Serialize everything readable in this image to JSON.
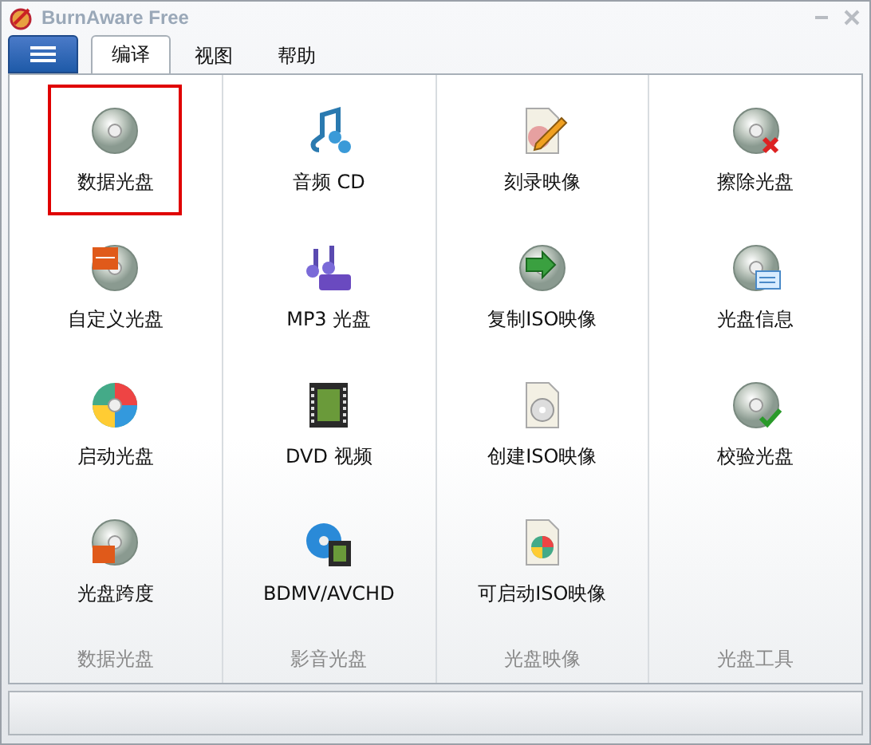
{
  "window": {
    "title": "BurnAware Free"
  },
  "tabs": [
    {
      "label": "编译",
      "selected": true
    },
    {
      "label": "视图",
      "selected": false
    },
    {
      "label": "帮助",
      "selected": false
    }
  ],
  "groups": [
    {
      "label": "数据光盘",
      "items": [
        {
          "label": "数据光盘",
          "kind": "disc",
          "selected": true
        },
        {
          "label": "自定义光盘",
          "kind": "iso",
          "selected": false
        },
        {
          "label": "启动光盘",
          "kind": "boot",
          "selected": false
        },
        {
          "label": "光盘跨度",
          "kind": "span",
          "selected": false
        }
      ]
    },
    {
      "label": "影音光盘",
      "items": [
        {
          "label": "音频 CD",
          "kind": "music",
          "selected": false
        },
        {
          "label": "MP3 光盘",
          "kind": "mp3",
          "selected": false
        },
        {
          "label": "DVD 视频",
          "kind": "film",
          "selected": false
        },
        {
          "label": "BDMV/AVCHD",
          "kind": "bluray",
          "selected": false
        }
      ]
    },
    {
      "label": "光盘映像",
      "items": [
        {
          "label": "刻录映像",
          "kind": "burnimage",
          "selected": false
        },
        {
          "label": "复制ISO映像",
          "kind": "copy",
          "selected": false
        },
        {
          "label": "创建ISO映像",
          "kind": "file",
          "selected": false
        },
        {
          "label": "可启动ISO映像",
          "kind": "bootfile",
          "selected": false
        }
      ]
    },
    {
      "label": "光盘工具",
      "items": [
        {
          "label": "擦除光盘",
          "kind": "erase",
          "selected": false
        },
        {
          "label": "光盘信息",
          "kind": "info",
          "selected": false
        },
        {
          "label": "校验光盘",
          "kind": "verify",
          "selected": false
        }
      ]
    }
  ]
}
